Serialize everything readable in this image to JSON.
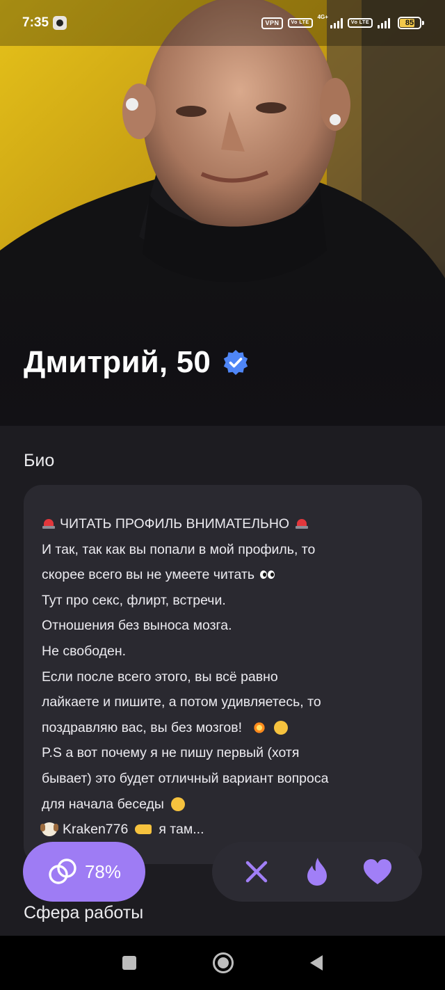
{
  "status_bar": {
    "time": "7:35",
    "vpn_label": "VPN",
    "volte_label": "Vo LTE",
    "network_label": "4G+",
    "battery_level": "85"
  },
  "profile": {
    "name_age": "Дмитрий, 50",
    "verified": true
  },
  "sections": {
    "bio_title": "Био",
    "work_title": "Сфера работы"
  },
  "bio_lines": [
    "ЧИТАТЬ ПРОФИЛЬ ВНИМАТЕЛЬНО",
    "И так, так как вы попали в мой профиль, то",
    "скорее всего вы не умеете читать",
    "Тут про секс, флирт, встречи.",
    "Отношения без выноса мозга.",
    "Не свободен.",
    "Если после всего этого, вы всё равно",
    "лайкаете и пишите, а потом удивляетесь, то",
    "поздравляю вас, вы без мозгов!",
    "P.S а вот почему я не пишу первый (хотя",
    "бывает) это будет отличный вариант вопроса",
    "для начала беседы",
    "Kraken776",
    "я там..."
  ],
  "match": {
    "percent": "78%"
  },
  "actions": {
    "dislike": "close-icon",
    "superlike": "flame-icon",
    "like": "heart-icon"
  },
  "colors": {
    "accent": "#9e7cf4",
    "verified": "#4f86f7",
    "background": "#1d1c21",
    "card": "#2a2930"
  }
}
